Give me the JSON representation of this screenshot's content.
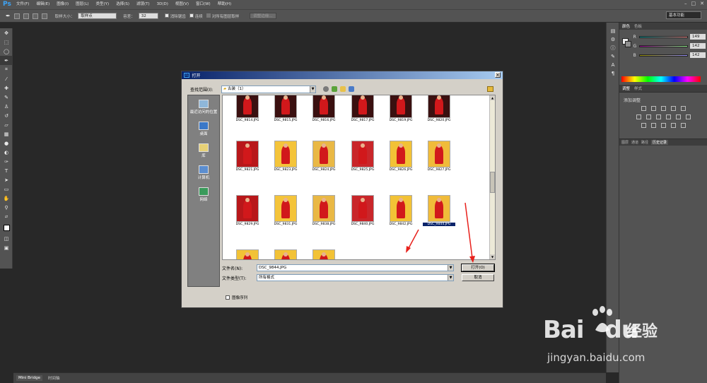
{
  "app": {
    "logo": "Ps",
    "workspace": "基本功能"
  },
  "menu": [
    "文件(F)",
    "编辑(E)",
    "图像(I)",
    "图层(L)",
    "类型(Y)",
    "选择(S)",
    "滤镜(T)",
    "3D(D)",
    "视图(V)",
    "窗口(W)",
    "帮助(H)"
  ],
  "options": {
    "sample_size_label": "取样大小：",
    "sample_size_value": "取样点",
    "tolerance_label": "容差：",
    "tolerance_value": "32",
    "antialias": "消除锯齿",
    "contiguous": "连续",
    "all_layers": "对所有图层取样",
    "refine_edge": "调整边缘..."
  },
  "color_panel": {
    "tabs": [
      "颜色",
      "色板"
    ],
    "r_label": "R",
    "r_value": "149",
    "g_label": "G",
    "g_value": "142",
    "b_label": "B",
    "b_value": "142"
  },
  "adjust_panel": {
    "tabs": [
      "调整",
      "样式"
    ],
    "title": "添加调整"
  },
  "layers_tabs": [
    "图层",
    "通道",
    "路径",
    "历史记录"
  ],
  "bottom_tabs": [
    "Mini Bridge",
    "时间轴"
  ],
  "dialog": {
    "title": "打开",
    "lookin_label": "查找范围(I):",
    "lookin_value": "古装（1）",
    "places": [
      "最近访问的位置",
      "桌面",
      "库",
      "计算机",
      "网络"
    ],
    "files": [
      "DSC_9814.JPG",
      "DSC_9815.JPG",
      "DSC_9816.JPG",
      "DSC_9817.JPG",
      "DSC_9819.JPG",
      "DSC_9820.JPG",
      "DSC_9821.JPG",
      "DSC_9823.JPG",
      "DSC_9824.JPG",
      "DSC_9825.JPG",
      "DSC_9826.JPG",
      "DSC_9827.JPG",
      "DSC_9829.JPG",
      "DSC_9831.JPG",
      "DSC_9838.JPG",
      "DSC_9840.JPG",
      "DSC_9842.JPG",
      "DSC_9844.JPG"
    ],
    "selected_file": "DSC_9844.JPG",
    "filename_label": "文件名(N):",
    "filename_value": "DSC_9844.JPG",
    "filetype_label": "文件类型(T):",
    "filetype_value": "所有格式",
    "open_button": "打开(O)",
    "cancel_button": "取消",
    "image_sequence": "图像序列"
  },
  "watermark": {
    "brand": "Bai",
    "brand2": "经验",
    "brand_tail": "du",
    "url": "jingyan.baidu.com"
  },
  "colors": {
    "accent": "#3da3f5",
    "arrow": "#e8211c",
    "selection": "#0a246a"
  }
}
